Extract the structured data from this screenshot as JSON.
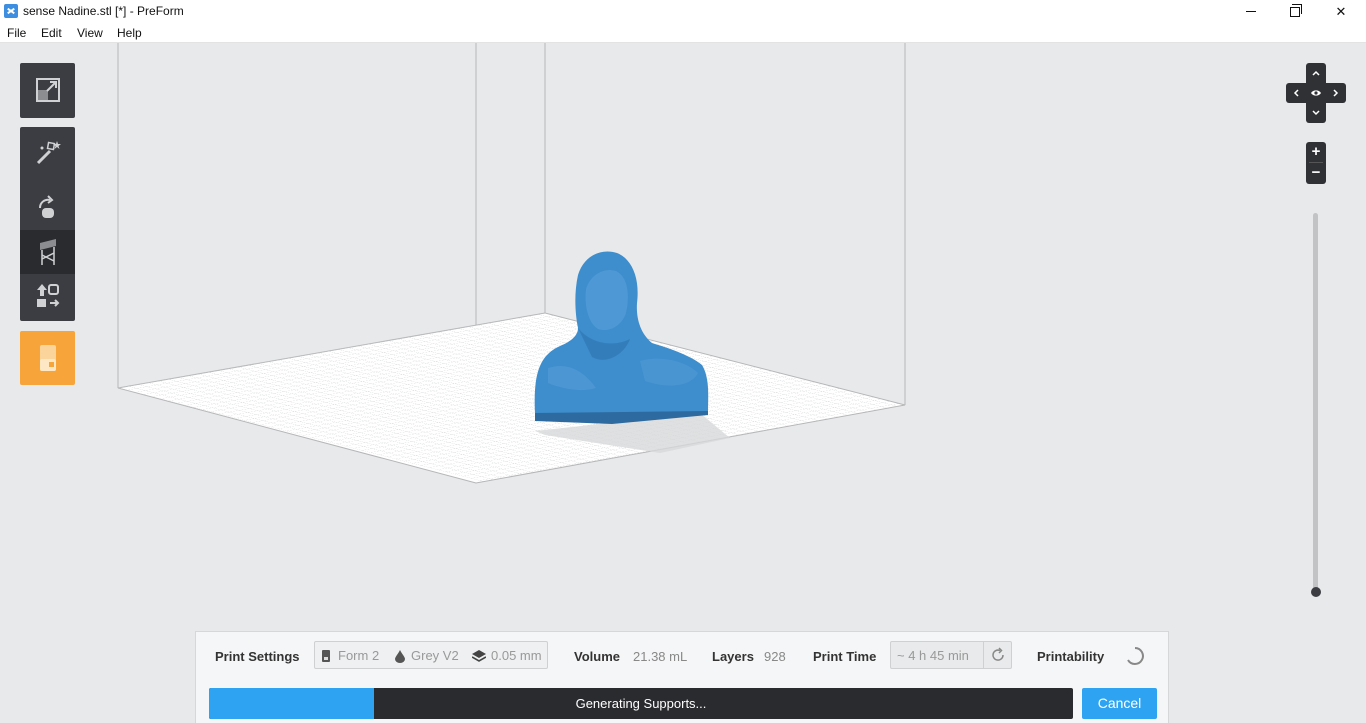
{
  "window": {
    "title": "sense Nadine.stl [*] - PreForm",
    "minimize": "",
    "close": "✕"
  },
  "menu": {
    "items": [
      "File",
      "Edit",
      "View",
      "Help"
    ]
  },
  "toolbar": {
    "tools": [
      "fit-view",
      "one-click-print",
      "orientation",
      "supports",
      "layout",
      "job-setup"
    ],
    "active_tool": "supports",
    "accent_color": "#f7a43a"
  },
  "navigation": {
    "zoom_in": "+",
    "zoom_out": "−"
  },
  "status": {
    "print_settings_label": "Print Settings",
    "printer": "Form 2",
    "material": "Grey V2",
    "layer_height": "0.05 mm",
    "volume_label": "Volume",
    "volume_value": "21.38 mL",
    "layers_label": "Layers",
    "layers_value": "928",
    "print_time_label": "Print Time",
    "print_time_value": "~ 4 h 45 min",
    "printability_label": "Printability"
  },
  "progress": {
    "text": "Generating Supports...",
    "fraction": 0.191,
    "cancel_label": "Cancel",
    "fill_color": "#2ea3f2"
  },
  "model": {
    "color": "#3e8dcc"
  }
}
